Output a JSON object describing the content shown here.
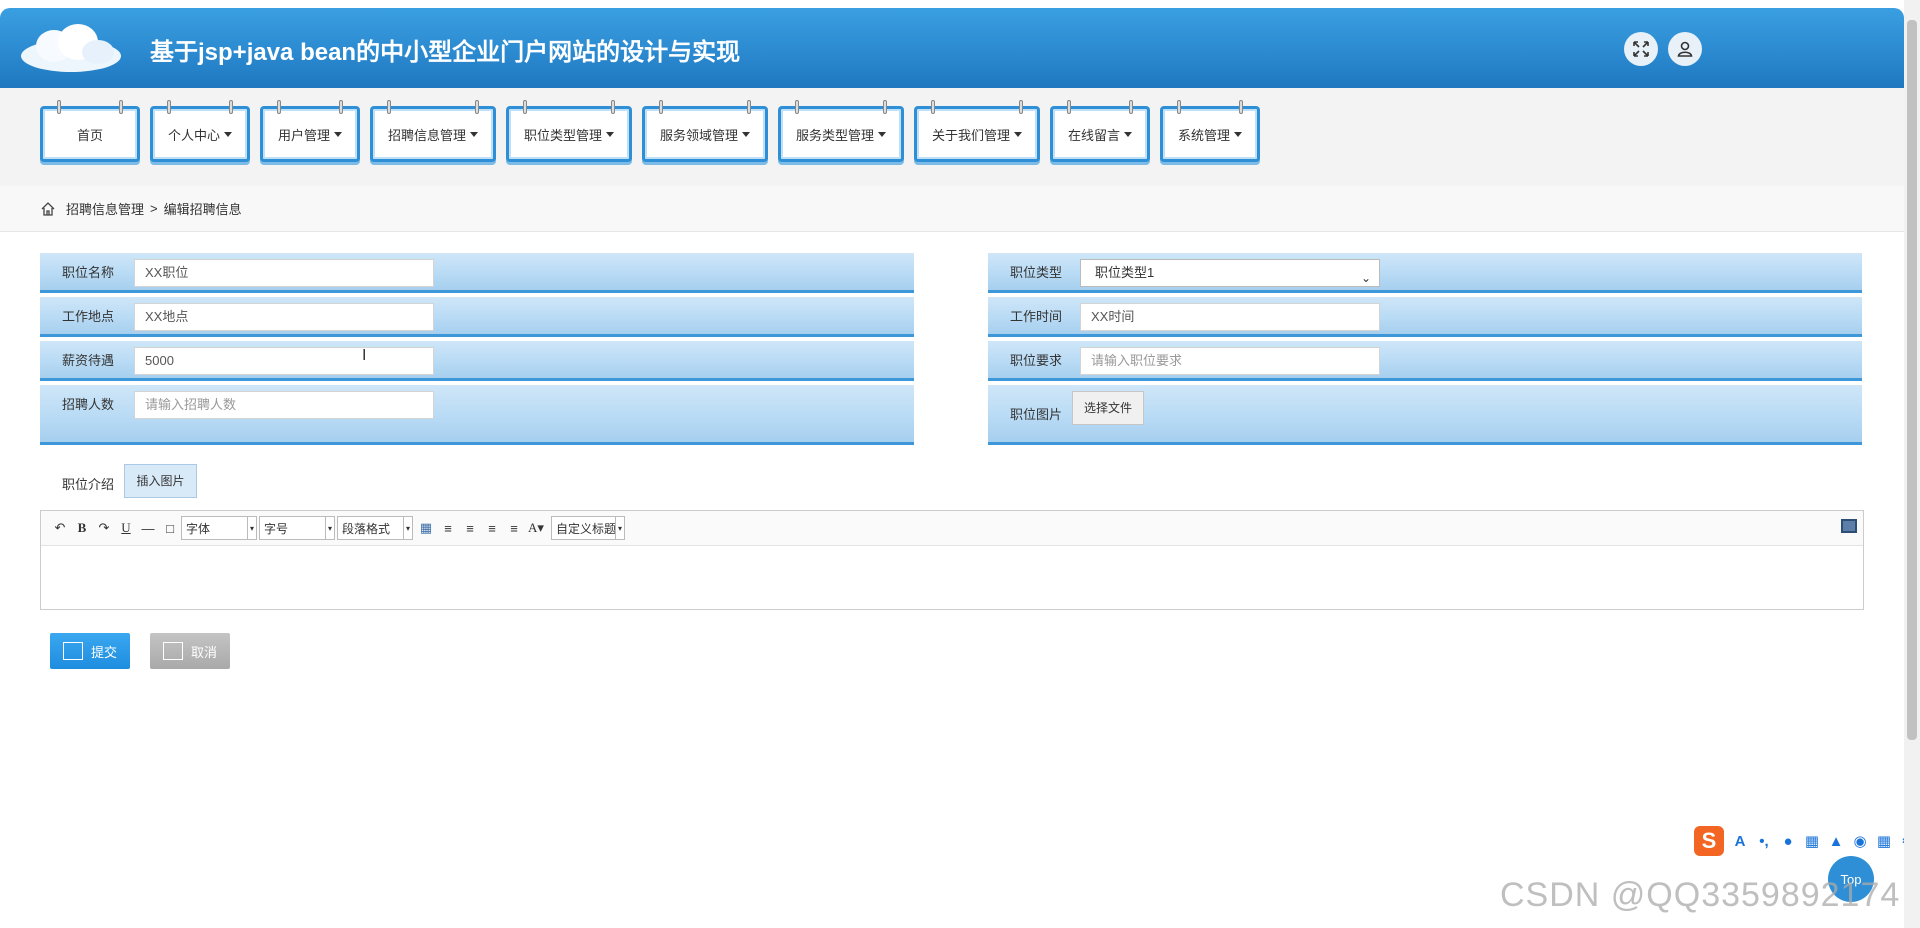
{
  "header": {
    "title": "基于jsp+java bean的中小型企业门户网站的设计与实现"
  },
  "nav": {
    "items": [
      {
        "label": "首页",
        "dropdown": false
      },
      {
        "label": "个人中心",
        "dropdown": true
      },
      {
        "label": "用户管理",
        "dropdown": true
      },
      {
        "label": "招聘信息管理",
        "dropdown": true
      },
      {
        "label": "职位类型管理",
        "dropdown": true
      },
      {
        "label": "服务领域管理",
        "dropdown": true
      },
      {
        "label": "服务类型管理",
        "dropdown": true
      },
      {
        "label": "关于我们管理",
        "dropdown": true
      },
      {
        "label": "在线留言",
        "dropdown": true
      },
      {
        "label": "系统管理",
        "dropdown": true
      }
    ]
  },
  "breadcrumb": {
    "parent": "招聘信息管理",
    "separator": ">",
    "current": "编辑招聘信息"
  },
  "form": {
    "job_name": {
      "label": "职位名称",
      "value": "XX职位"
    },
    "work_location": {
      "label": "工作地点",
      "value": "XX地点"
    },
    "salary": {
      "label": "薪资待遇",
      "value": "5000"
    },
    "headcount": {
      "label": "招聘人数",
      "placeholder": "请输入招聘人数"
    },
    "job_type": {
      "label": "职位类型",
      "value": "职位类型1"
    },
    "work_time": {
      "label": "工作时间",
      "value": "XX时间"
    },
    "requirements": {
      "label": "职位要求",
      "placeholder": "请输入职位要求"
    },
    "job_image": {
      "label": "职位图片",
      "button": "选择文件"
    },
    "intro": {
      "label": "职位介绍",
      "insert_image": "插入图片"
    }
  },
  "editor": {
    "font_family": "字体",
    "font_size": "字号",
    "paragraph": "段落格式",
    "custom_title": "自定义标题"
  },
  "actions": {
    "submit": "提交",
    "cancel": "取消"
  },
  "ime": {
    "logo": "S"
  },
  "top_button": "Top",
  "watermark": "CSDN @QQ3359892174"
}
